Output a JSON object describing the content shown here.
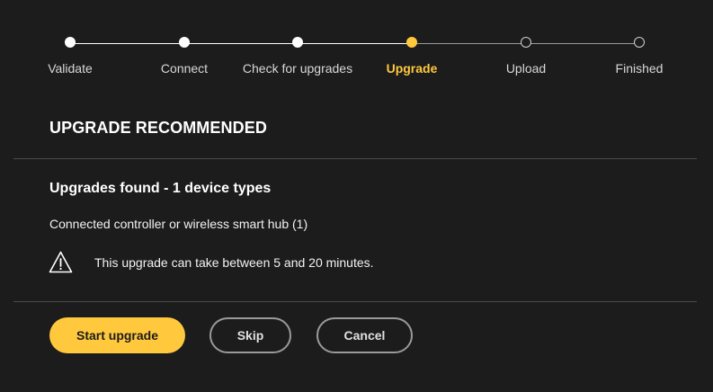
{
  "stepper": {
    "steps": [
      {
        "label": "Validate",
        "state": "done"
      },
      {
        "label": "Connect",
        "state": "done"
      },
      {
        "label": "Check for upgrades",
        "state": "done"
      },
      {
        "label": "Upgrade",
        "state": "current"
      },
      {
        "label": "Upload",
        "state": "todo"
      },
      {
        "label": "Finished",
        "state": "todo"
      }
    ]
  },
  "header": {
    "title": "UPGRADE RECOMMENDED"
  },
  "content": {
    "subtitle": "Upgrades found - 1 device types",
    "device": "Connected controller or wireless smart hub (1)",
    "warning_icon": "warning-triangle-icon",
    "warning_text": "This upgrade can take between 5 and 20 minutes."
  },
  "actions": {
    "start_label": "Start upgrade",
    "skip_label": "Skip",
    "cancel_label": "Cancel"
  },
  "colors": {
    "background": "#1c1c1c",
    "accent": "#ffc83d",
    "divider": "#4a4a4a"
  }
}
